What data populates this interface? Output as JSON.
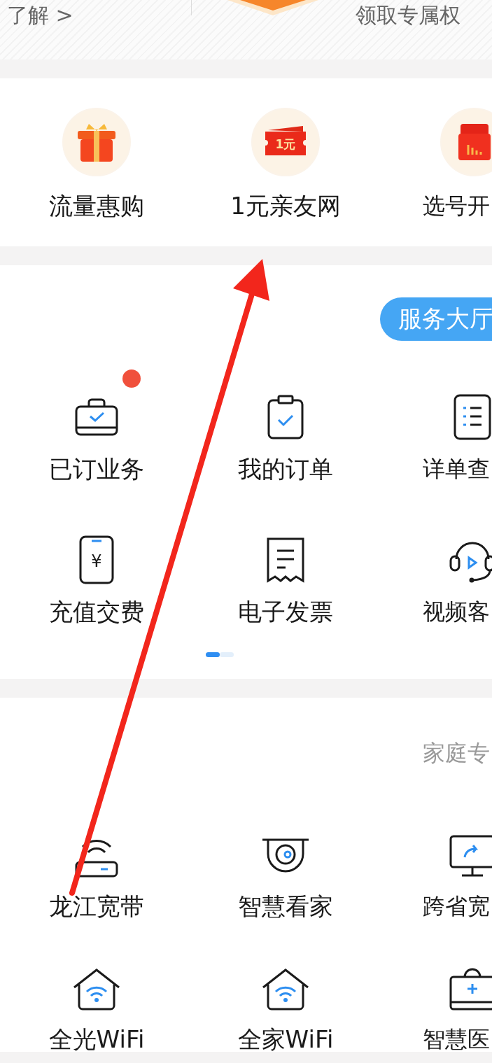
{
  "top_banner": {
    "left_link": "了解 >",
    "right_text": "领取专属权"
  },
  "promos": [
    {
      "label": "流量惠购",
      "kind": "gift"
    },
    {
      "label": "1元亲友网",
      "kind": "ticket",
      "icon_text": "1元"
    },
    {
      "label": "选号开",
      "kind": "card"
    }
  ],
  "service_hall": {
    "button": "服务大厅",
    "items": [
      {
        "label": "已订业务",
        "kind": "bag",
        "badge": true
      },
      {
        "label": "我的订单",
        "kind": "clipboard",
        "badge": false
      },
      {
        "label": "详单查",
        "kind": "list",
        "badge": false
      },
      {
        "label": "充值交费",
        "kind": "phone",
        "icon_text": "¥",
        "badge": false
      },
      {
        "label": "电子发票",
        "kind": "receipt",
        "badge": false
      },
      {
        "label": "视频客",
        "kind": "headset",
        "badge": false
      }
    ],
    "pages": [
      {
        "selected": true
      },
      {
        "selected": false
      }
    ]
  },
  "family": {
    "title": "家庭专",
    "items": [
      {
        "label": "龙江宽带",
        "kind": "router"
      },
      {
        "label": "智慧看家",
        "kind": "camera"
      },
      {
        "label": "跨省宽",
        "kind": "monitor"
      },
      {
        "label": "全光WiFi",
        "kind": "house"
      },
      {
        "label": "全家WiFi",
        "kind": "house"
      },
      {
        "label": "智慧医",
        "kind": "medkit"
      }
    ]
  }
}
